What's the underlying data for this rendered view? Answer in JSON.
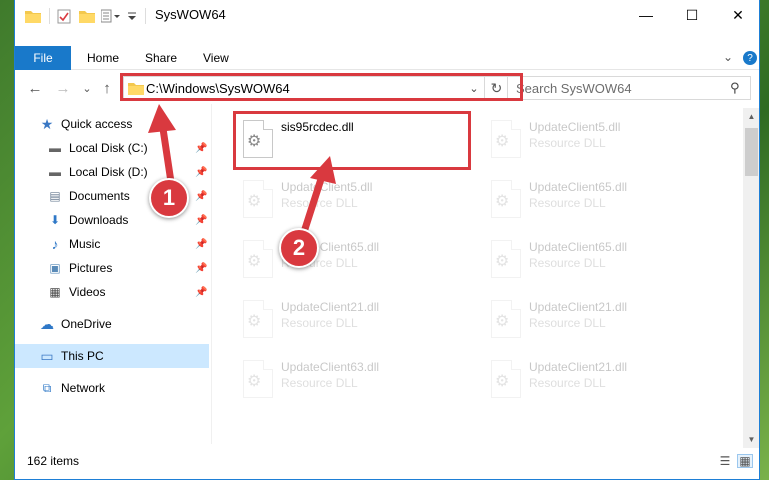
{
  "window": {
    "title": "SysWOW64",
    "controls": {
      "minimize": "—",
      "maximize": "☐",
      "close": "✕"
    }
  },
  "ribbon": {
    "tabs": [
      {
        "label": "File"
      },
      {
        "label": "Home"
      },
      {
        "label": "Share"
      },
      {
        "label": "View"
      }
    ],
    "expand_glyph": "⌄",
    "help_glyph": "?"
  },
  "navigation": {
    "back_glyph": "←",
    "forward_glyph": "→",
    "recent_glyph": "⌄",
    "up_glyph": "↑",
    "address": "C:\\Windows\\SysWOW64",
    "address_dropdown_glyph": "⌄",
    "refresh_glyph": "↻",
    "search_placeholder": "Search SysWOW64",
    "search_glyph": "⚲"
  },
  "sidebar": {
    "items": [
      {
        "label": "Quick access",
        "icon": "star-icon",
        "glyph": "★",
        "color": "#3a78c4",
        "pinned": false
      },
      {
        "label": "Local Disk (C:)",
        "icon": "drive-icon",
        "glyph": "▬",
        "color": "#666666",
        "pinned": true
      },
      {
        "label": "Local Disk (D:)",
        "icon": "drive-icon",
        "glyph": "▬",
        "color": "#666666",
        "pinned": true
      },
      {
        "label": "Documents",
        "icon": "documents-icon",
        "glyph": "▤",
        "color": "#6a7c93",
        "pinned": true
      },
      {
        "label": "Downloads",
        "icon": "download-icon",
        "glyph": "⬇",
        "color": "#2f78c7",
        "pinned": true
      },
      {
        "label": "Music",
        "icon": "music-icon",
        "glyph": "♪",
        "color": "#2f78c7",
        "pinned": true
      },
      {
        "label": "Pictures",
        "icon": "pictures-icon",
        "glyph": "▣",
        "color": "#5a8bb8",
        "pinned": true
      },
      {
        "label": "Videos",
        "icon": "videos-icon",
        "glyph": "▦",
        "color": "#4a4a4a",
        "pinned": true
      },
      {
        "label": "OneDrive",
        "icon": "cloud-icon",
        "glyph": "☁",
        "color": "#2f78c7",
        "pinned": false
      },
      {
        "label": "This PC",
        "icon": "computer-icon",
        "glyph": "▭",
        "color": "#3a78c4",
        "pinned": false
      },
      {
        "label": "Network",
        "icon": "network-icon",
        "glyph": "⧉",
        "color": "#2f78c7",
        "pinned": false
      }
    ],
    "pin_glyph": "📌"
  },
  "files": [
    {
      "name": "sis95rcdec.dll",
      "type": "",
      "highlighted": true
    },
    {
      "name": "UpdateClient5.dll",
      "type": "Resource DLL",
      "highlighted": false
    },
    {
      "name": "UpdateClient5.dll",
      "type": "Resource DLL",
      "highlighted": false
    },
    {
      "name": "UpdateClient65.dll",
      "type": "Resource DLL",
      "highlighted": false
    },
    {
      "name": "UpdateClient65.dll",
      "type": "Resource DLL",
      "highlighted": false
    },
    {
      "name": "UpdateClient65.dll",
      "type": "Resource DLL",
      "highlighted": false
    },
    {
      "name": "UpdateClient21.dll",
      "type": "Resource DLL",
      "highlighted": false
    },
    {
      "name": "UpdateClient21.dll",
      "type": "Resource DLL",
      "highlighted": false
    },
    {
      "name": "UpdateClient63.dll",
      "type": "Resource DLL",
      "highlighted": false
    },
    {
      "name": "UpdateClient21.dll",
      "type": "Resource DLL",
      "highlighted": false
    }
  ],
  "file_icon_glyph": "⚙",
  "scrollbar": {
    "up_glyph": "▲",
    "down_glyph": "▼"
  },
  "status": {
    "item_count": "162 items",
    "details_view_glyph": "☰",
    "large_icons_glyph": "▦"
  },
  "annotations": {
    "markers": [
      {
        "label": "1"
      },
      {
        "label": "2"
      }
    ],
    "color": "#d9393f"
  }
}
